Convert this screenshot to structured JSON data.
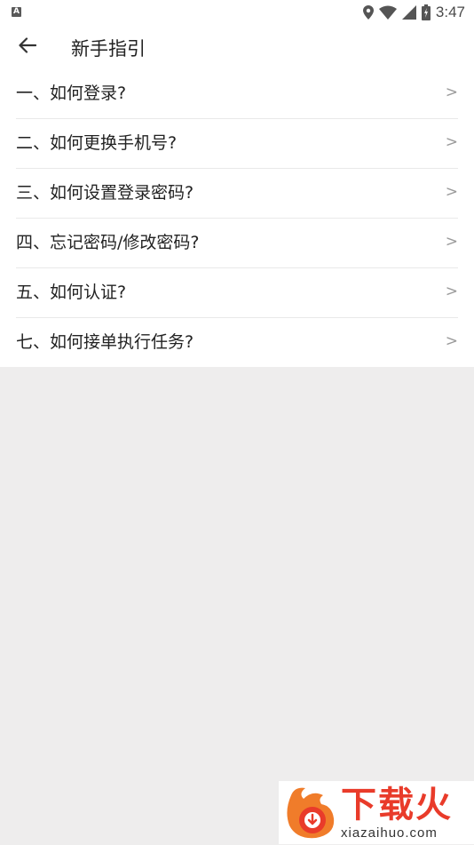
{
  "status_bar": {
    "left_icon_label": "A",
    "time": "3:47",
    "icons": [
      "location-icon",
      "wifi-icon",
      "signal-icon",
      "battery-icon"
    ]
  },
  "app_bar": {
    "back_icon": "arrow-left-icon",
    "title": "新手指引"
  },
  "guide_items": [
    {
      "label": "一、如何登录?",
      "chevron": ">"
    },
    {
      "label": "二、如何更换手机号?",
      "chevron": ">"
    },
    {
      "label": "三、如何设置登录密码?",
      "chevron": ">"
    },
    {
      "label": "四、忘记密码/修改密码?",
      "chevron": ">"
    },
    {
      "label": "五、如何认证?",
      "chevron": ">"
    },
    {
      "label": "七、如何接单执行任务?",
      "chevron": ">"
    }
  ],
  "watermark": {
    "brand": "下载火",
    "url": "xiazaihuo.com"
  },
  "colors": {
    "background": "#eeeded",
    "surface": "#ffffff",
    "text": "#222222",
    "chevron": "#9a9a9a",
    "divider": "#e9e9e9",
    "watermark_accent": "#e93b2a"
  }
}
